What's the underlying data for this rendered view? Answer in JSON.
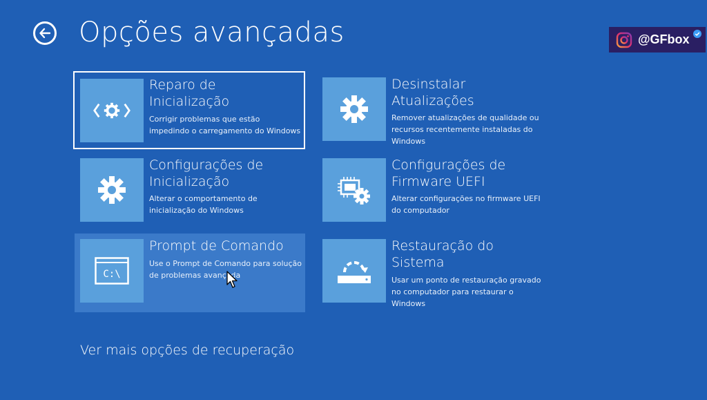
{
  "header": {
    "title": "Opções avançadas"
  },
  "badge": {
    "handle": "@GFbox"
  },
  "tiles": [
    {
      "title_line1": "Reparo de",
      "title_line2": "Inicialização",
      "description": "Corrigir problemas que estão impedindo o carregamento do Windows",
      "icon": "startup-repair-icon"
    },
    {
      "title_line1": "Desinstalar",
      "title_line2": "Atualizações",
      "description": "Remover atualizações de qualidade ou recursos recentemente instaladas do Windows",
      "icon": "gear-icon"
    },
    {
      "title_line1": "Configurações de",
      "title_line2": "Inicialização",
      "description": "Alterar o comportamento de inicialização do Windows",
      "icon": "gear-icon"
    },
    {
      "title_line1": "Configurações de",
      "title_line2": "Firmware UEFI",
      "description": "Alterar configurações no firmware UEFI do computador",
      "icon": "firmware-chip-gear-icon"
    },
    {
      "title_line1": "Prompt de Comando",
      "title_line2": "",
      "description": "Use o Prompt de Comando para solução de problemas avançada",
      "icon": "command-prompt-icon",
      "icon_text": "C:\\"
    },
    {
      "title_line1": "Restauração do",
      "title_line2": "Sistema",
      "description": "Usar um ponto de restauração gravado no computador para restaurar o Windows",
      "icon": "system-restore-icon"
    }
  ],
  "footer": {
    "more_options": "Ver mais opções de recuperação"
  },
  "colors": {
    "background": "#1f5fb5",
    "icon_box": "#5aa0dc",
    "hover_tile": "#3b7ac9",
    "badge_bg": "#2a1f63"
  }
}
